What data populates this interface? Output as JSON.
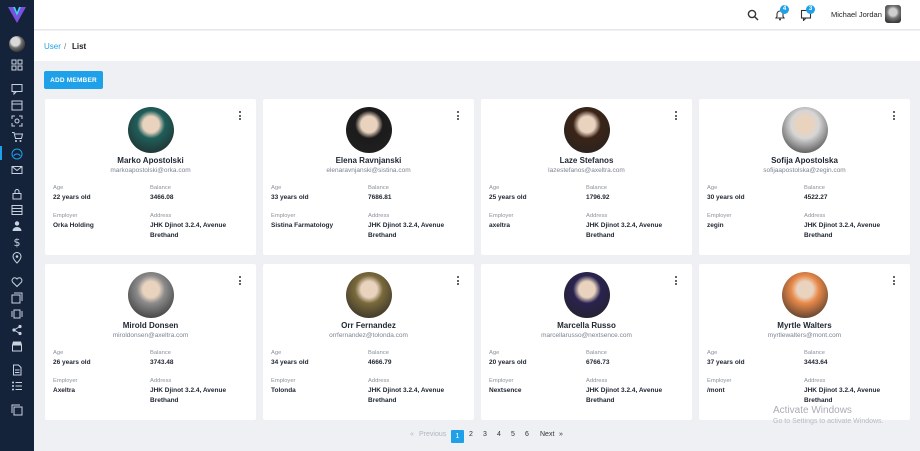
{
  "header": {
    "notifications_count": "4",
    "messages_count": "3",
    "user_name": "Michael Jordan"
  },
  "breadcrumb": {
    "parent": "User",
    "separator": "/",
    "current": "List"
  },
  "actions": {
    "add_member_label": "ADD MEMBER"
  },
  "field_labels": {
    "age": "Age",
    "balance": "Balance",
    "employer": "Employer",
    "address": "Address"
  },
  "members": [
    {
      "name": "Marko Apostolski",
      "email": "markoapostolski@orka.com",
      "age": "22 years old",
      "balance": "3466.08",
      "employer": "Orka Holding",
      "address1": "JHK Djinot 3.2.4, Avenue",
      "address2": "Brethand",
      "avatar_color": "#1f5e5a"
    },
    {
      "name": "Elena Ravnjanski",
      "email": "elenaravnjanski@sistina.com",
      "age": "33 years old",
      "balance": "7686.81",
      "employer": "Sistina Farmatology",
      "address1": "JHK Djinot 3.2.4, Avenue",
      "address2": "Brethand",
      "avatar_color": "#1b1b1b"
    },
    {
      "name": "Laze Stefanos",
      "email": "lazestefanos@axeltra.com",
      "age": "25 years old",
      "balance": "1796.92",
      "employer": "axeltra",
      "address1": "JHK Djinot 3.2.4, Avenue",
      "address2": "Brethand",
      "avatar_color": "#3b2417"
    },
    {
      "name": "Sofija Apostolska",
      "email": "sofijaapostolska@zegin.com",
      "age": "30 years old",
      "balance": "4522.27",
      "employer": "zegin",
      "address1": "JHK Djinot 3.2.4, Avenue",
      "address2": "Brethand",
      "avatar_color": "#d6d6d6"
    },
    {
      "name": "Mirold Donsen",
      "email": "miroldonsen@axeltra.com",
      "age": "26 years old",
      "balance": "3743.48",
      "employer": "Axeltra",
      "address1": "JHK Djinot 3.2.4, Avenue",
      "address2": "Brethand",
      "avatar_color": "#8c8c8c"
    },
    {
      "name": "Orr Fernandez",
      "email": "orrfernandez@tolonda.com",
      "age": "34 years old",
      "balance": "4666.79",
      "employer": "Tolonda",
      "address1": "JHK Djinot 3.2.4, Avenue",
      "address2": "Brethand",
      "avatar_color": "#7a6a3c"
    },
    {
      "name": "Marcella Russo",
      "email": "marcellarusso@nextsence.com",
      "age": "20 years old",
      "balance": "6766.73",
      "employer": "Nextsence",
      "address1": "JHK Djinot 3.2.4, Avenue",
      "address2": "Brethand",
      "avatar_color": "#2a2350"
    },
    {
      "name": "Myrtle Walters",
      "email": "myrtlewalters@mont.com",
      "age": "37 years old",
      "balance": "3443.64",
      "employer": "/mont",
      "address1": "JHK Djinot 3.2.4, Avenue",
      "address2": "Brethand",
      "avatar_color": "#e8894a"
    }
  ],
  "pagination": {
    "previous": "Previous",
    "pages": [
      "1",
      "2",
      "3",
      "4",
      "5",
      "6"
    ],
    "current": "1",
    "next": "Next",
    "next_arrow": "»",
    "prev_arrow": "«"
  },
  "watermark": {
    "line1": "Activate Windows",
    "line2": "Go to Settings to activate Windows."
  },
  "colors": {
    "accent": "#1ea1e8",
    "sidebar": "#15233a"
  }
}
